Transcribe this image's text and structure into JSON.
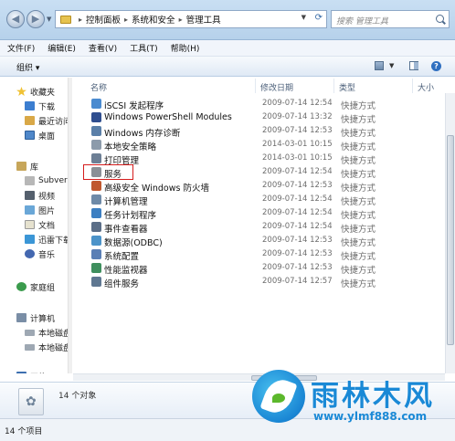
{
  "addressbar": {
    "path": [
      "控制面板",
      "系统和安全",
      "管理工具"
    ],
    "search_placeholder": "搜索 管理工具"
  },
  "menubar": [
    "文件(F)",
    "编辑(E)",
    "查看(V)",
    "工具(T)",
    "帮助(H)"
  ],
  "toolbar": {
    "organize_label": "组织 ▾",
    "help_label": "?"
  },
  "navpane": {
    "favorites": {
      "label": "收藏夹",
      "items": [
        "下载",
        "最近访问",
        "桌面"
      ]
    },
    "libraries": {
      "label": "库",
      "items": [
        "Subversion",
        "视频",
        "图片",
        "文档",
        "迅雷下载",
        "音乐"
      ]
    },
    "homegroup": "家庭组",
    "computer": {
      "label": "计算机",
      "items": [
        "本地磁盘",
        "本地磁盘"
      ]
    },
    "network": "网络"
  },
  "columns": {
    "name": "名称",
    "modified": "修改日期",
    "type": "类型",
    "size": "大小"
  },
  "files": [
    {
      "name": "iSCSI 发起程序",
      "modified": "2009-07-14 12:54",
      "type": "快捷方式",
      "icon": "iscsi-icon",
      "color": "#4a8bd0"
    },
    {
      "name": "Windows PowerShell Modules",
      "modified": "2009-07-14 13:32",
      "type": "快捷方式",
      "icon": "powershell-icon",
      "color": "#2f4e8f"
    },
    {
      "name": "Windows 内存诊断",
      "modified": "2009-07-14 12:53",
      "type": "快捷方式",
      "icon": "memory-diagnostic-icon",
      "color": "#5a7fa8"
    },
    {
      "name": "本地安全策略",
      "modified": "2014-03-01 10:15",
      "type": "快捷方式",
      "icon": "security-policy-icon",
      "color": "#8c9bab"
    },
    {
      "name": "打印管理",
      "modified": "2014-03-01 10:15",
      "type": "快捷方式",
      "icon": "print-icon",
      "color": "#6d7f95"
    },
    {
      "name": "服务",
      "modified": "2009-07-14 12:54",
      "type": "快捷方式",
      "icon": "services-icon",
      "color": "#8a8f96"
    },
    {
      "name": "高级安全 Windows 防火墙",
      "modified": "2009-07-14 12:53",
      "type": "快捷方式",
      "icon": "firewall-icon",
      "color": "#c0582e"
    },
    {
      "name": "计算机管理",
      "modified": "2009-07-14 12:54",
      "type": "快捷方式",
      "icon": "computer-management-icon",
      "color": "#6e8aa8"
    },
    {
      "name": "任务计划程序",
      "modified": "2009-07-14 12:54",
      "type": "快捷方式",
      "icon": "task-scheduler-icon",
      "color": "#3c7fc2"
    },
    {
      "name": "事件查看器",
      "modified": "2009-07-14 12:54",
      "type": "快捷方式",
      "icon": "event-viewer-icon",
      "color": "#5b6e87"
    },
    {
      "name": "数据源(ODBC)",
      "modified": "2009-07-14 12:53",
      "type": "快捷方式",
      "icon": "odbc-icon",
      "color": "#4c93c9"
    },
    {
      "name": "系统配置",
      "modified": "2009-07-14 12:53",
      "type": "快捷方式",
      "icon": "system-config-icon",
      "color": "#5a7fb5"
    },
    {
      "name": "性能监视器",
      "modified": "2009-07-14 12:53",
      "type": "快捷方式",
      "icon": "performance-monitor-icon",
      "color": "#3f8f5e"
    },
    {
      "name": "组件服务",
      "modified": "2009-07-14 12:57",
      "type": "快捷方式",
      "icon": "component-services-icon",
      "color": "#5f7791"
    }
  ],
  "details": {
    "count_text": "14 个对象"
  },
  "status": {
    "text": "14 个项目"
  },
  "watermark": {
    "title": "雨林木风",
    "url": "www.ylmf888.com"
  }
}
